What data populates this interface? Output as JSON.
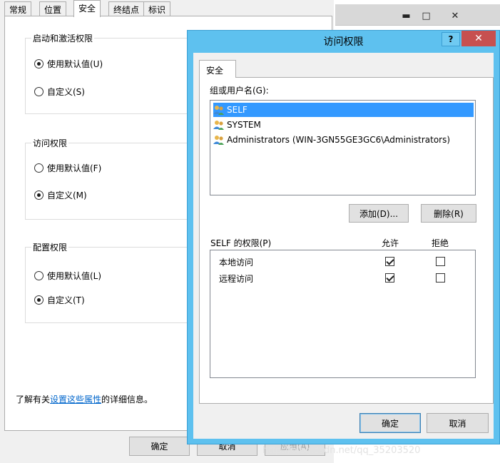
{
  "bg_dialog": {
    "tabs": [
      "常规",
      "位置",
      "安全",
      "终结点",
      "标识"
    ],
    "active_tab": "安全",
    "groups": [
      {
        "title": "启动和激活权限",
        "options": [
          {
            "label": "使用默认值(U)",
            "selected": true
          },
          {
            "label": "自定义(S)",
            "selected": false
          }
        ]
      },
      {
        "title": "访问权限",
        "options": [
          {
            "label": "使用默认值(F)",
            "selected": false
          },
          {
            "label": "自定义(M)",
            "selected": true
          }
        ]
      },
      {
        "title": "配置权限",
        "options": [
          {
            "label": "使用默认值(L)",
            "selected": false
          },
          {
            "label": "自定义(T)",
            "selected": true
          }
        ]
      }
    ],
    "info_prefix": "了解有关",
    "info_link": "设置这些属性",
    "info_suffix": "的详细信息。",
    "ok_label": "确定",
    "cancel_label": "取消",
    "apply_label": "应用(A)"
  },
  "bg_window": {
    "minimize": "▬",
    "maximize": "□",
    "close": "✕",
    "watermark": "http://blog.csdn.net/qq_35203520"
  },
  "dialog": {
    "title": "访问权限",
    "help_label": "?",
    "close_label": "✕",
    "tab_label": "安全",
    "group_label": "组或用户名(G):",
    "users": [
      {
        "name": "SELF",
        "selected": true
      },
      {
        "name": "SYSTEM",
        "selected": false
      },
      {
        "name": "Administrators (WIN-3GN55GE3GC6\\Administrators)",
        "selected": false
      }
    ],
    "add_label": "添加(D)...",
    "remove_label": "删除(R)",
    "permissions_header": "SELF 的权限(P)",
    "allow_header": "允许",
    "deny_header": "拒绝",
    "permissions": [
      {
        "name": "本地访问",
        "allow": true,
        "deny": false
      },
      {
        "name": "远程访问",
        "allow": true,
        "deny": false
      }
    ],
    "ok_label": "确定",
    "cancel_label": "取消"
  },
  "colors": {
    "accent_frame": "#5ec1ef",
    "selection": "#3399ff",
    "close_button": "#c75050",
    "link": "#0066cc"
  }
}
